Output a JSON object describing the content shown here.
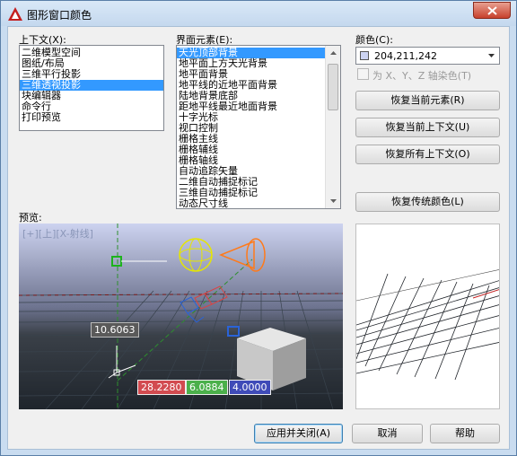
{
  "window": {
    "title": "图形窗口颜色"
  },
  "context": {
    "label": "上下文(X):",
    "items": [
      "二维模型空间",
      "图纸/布局",
      "三维平行投影",
      "三维透视投影",
      "块编辑器",
      "命令行",
      "打印预览"
    ],
    "selected_index": 3
  },
  "elements": {
    "label": "界面元素(E):",
    "items": [
      "天光顶部背景",
      "地平面上方天光背景",
      "地平面背景",
      "地平线的近地平面背景",
      "陆地背景底部",
      "距地平线最近地面背景",
      "十字光标",
      "视口控制",
      "栅格主线",
      "栅格辅线",
      "栅格轴线",
      "自动追踪矢量",
      "二维自动捕捉标记",
      "三维自动捕捉标记",
      "动态尺寸线"
    ],
    "selected_index": 0
  },
  "color": {
    "label": "颜色(C):",
    "value": "204,211,242",
    "swatch": "#ccd3f2",
    "tint_checkbox": "为 X、Y、Z 轴染色(T)"
  },
  "buttons": {
    "restore_element": "恢复当前元素(R)",
    "restore_context": "恢复当前上下文(U)",
    "restore_all": "恢复所有上下文(O)",
    "restore_classic": "恢复传统颜色(L)",
    "apply_close": "应用并关闭(A)",
    "cancel": "取消",
    "help": "帮助"
  },
  "preview": {
    "label": "预览:",
    "viewport_label": "[+][上][X-射线]",
    "dim_value": "10.6063",
    "coord_x": "28.2280",
    "coord_y": "6.0884",
    "coord_z": "4.0000"
  }
}
